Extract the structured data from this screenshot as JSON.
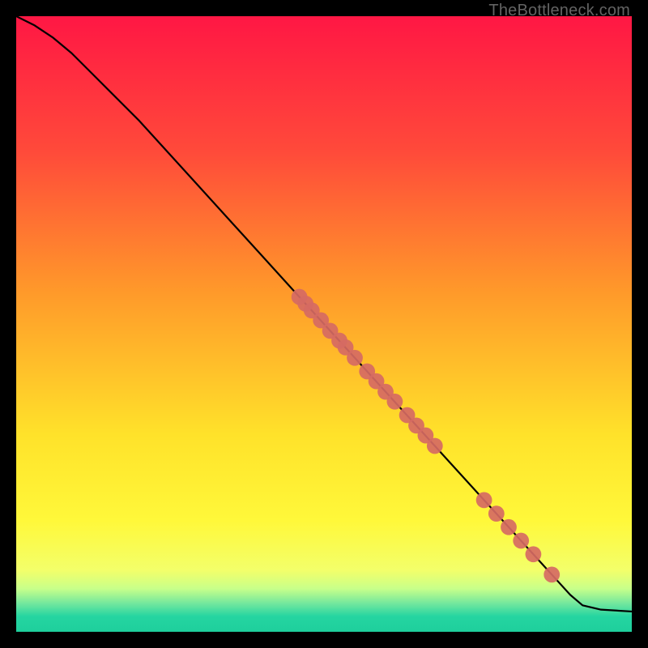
{
  "watermark": "TheBottleneck.com",
  "chart_data": {
    "type": "line",
    "title": "",
    "xlabel": "",
    "ylabel": "",
    "xlim": [
      0,
      100
    ],
    "ylim": [
      0,
      100
    ],
    "grid": false,
    "legend": false,
    "series": [
      {
        "name": "curve",
        "color": "#000000",
        "x": [
          0,
          3,
          6,
          9,
          12,
          15,
          20,
          25,
          30,
          35,
          40,
          45,
          50,
          55,
          60,
          65,
          70,
          75,
          80,
          85,
          88,
          90,
          92,
          95,
          100
        ],
        "y": [
          100,
          98.5,
          96.5,
          94,
          91,
          88,
          83,
          77.5,
          72,
          66.5,
          61,
          55.5,
          50,
          44.5,
          39,
          33.5,
          28,
          22.5,
          17,
          11.5,
          8.2,
          6,
          4.3,
          3.6,
          3.3
        ]
      }
    ],
    "markers": {
      "name": "points",
      "color": "#d66a63",
      "radius": 1.3,
      "x": [
        46,
        47,
        48,
        49.5,
        51,
        52.5,
        53.5,
        55,
        57,
        58.5,
        60,
        61.5,
        63.5,
        65,
        66.5,
        68,
        76,
        78,
        80,
        82,
        84,
        87
      ],
      "y": [
        54.4,
        53.3,
        52.2,
        50.6,
        48.9,
        47.3,
        46.2,
        44.5,
        42.3,
        40.7,
        39.0,
        37.4,
        35.2,
        33.5,
        31.9,
        30.2,
        21.4,
        19.2,
        17.0,
        14.8,
        12.6,
        9.3
      ]
    },
    "background_gradient": {
      "direction": "vertical",
      "stops": [
        {
          "pos": 0.0,
          "color": "#ff1744"
        },
        {
          "pos": 0.22,
          "color": "#ff4a3a"
        },
        {
          "pos": 0.45,
          "color": "#ff9a2a"
        },
        {
          "pos": 0.68,
          "color": "#ffe22a"
        },
        {
          "pos": 0.82,
          "color": "#fff83a"
        },
        {
          "pos": 0.9,
          "color": "#f3ff6a"
        },
        {
          "pos": 0.93,
          "color": "#c8ff8a"
        },
        {
          "pos": 0.955,
          "color": "#6fe69e"
        },
        {
          "pos": 0.975,
          "color": "#25d5a1"
        },
        {
          "pos": 1.0,
          "color": "#1ecf9c"
        }
      ]
    }
  }
}
